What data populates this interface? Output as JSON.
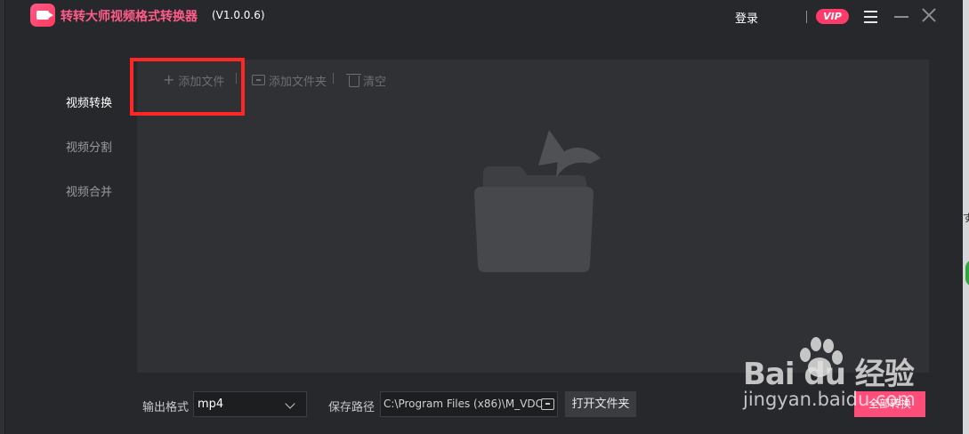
{
  "window": {
    "title": "转转大师视频格式转换器",
    "version": "(V1.0.0.6)",
    "login_label": "登录",
    "vip_label": "VIP",
    "accent_color": "#ff4d7a"
  },
  "sidebar": {
    "items": [
      {
        "label": "视频转换",
        "active": true
      },
      {
        "label": "视频分割",
        "active": false
      },
      {
        "label": "视频合并",
        "active": false
      }
    ]
  },
  "toolbar": {
    "add_file_label": "添加文件",
    "add_folder_label": "添加文件夹",
    "clear_label": "清空"
  },
  "bottom": {
    "output_format_label": "输出格式",
    "output_format_value": "mp4",
    "save_path_label": "保存路径",
    "save_path_value": "C:\\Program Files (x86)\\M_VDC",
    "open_folder_label": "打开文件夹",
    "convert_all_label": "全部转换"
  },
  "watermark": {
    "logo_text": "Bai  du 经验",
    "url": "jingyan.baidu.com"
  },
  "icons": [
    "logo-icon",
    "menu-icon",
    "minimize-icon",
    "close-icon",
    "plus-icon",
    "folder-icon",
    "trash-icon",
    "chevron-down-icon",
    "empty-folder-illustration"
  ]
}
